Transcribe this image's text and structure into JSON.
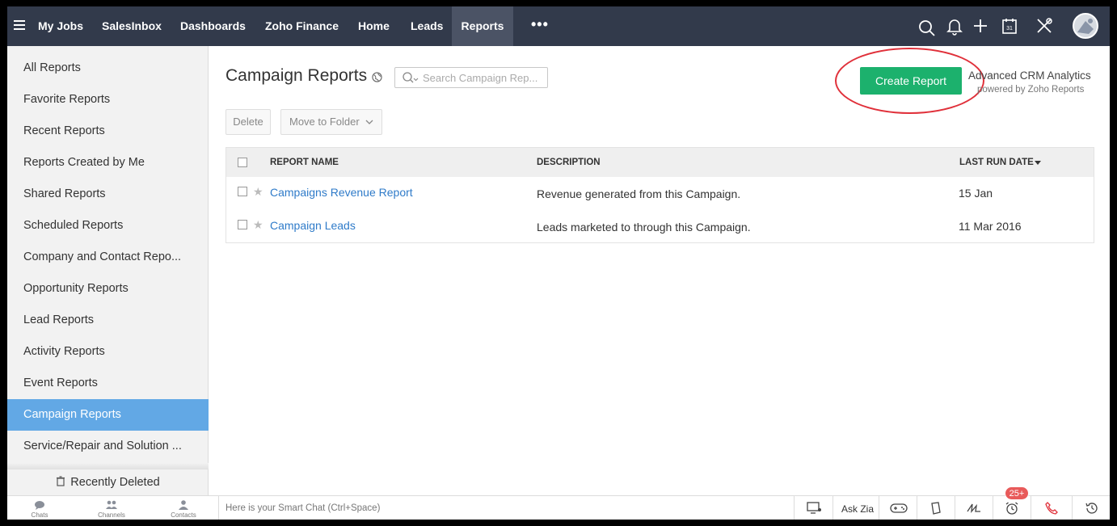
{
  "nav": {
    "items": [
      {
        "label": "My Jobs"
      },
      {
        "label": "SalesInbox"
      },
      {
        "label": "Dashboards"
      },
      {
        "label": "Zoho Finance"
      },
      {
        "label": "Home"
      },
      {
        "label": "Leads"
      },
      {
        "label": "Reports",
        "active": true
      }
    ],
    "more_label": "•••",
    "calendar_day": "31"
  },
  "sidebar": {
    "items": [
      {
        "label": "All Reports"
      },
      {
        "label": "Favorite Reports"
      },
      {
        "label": "Recent Reports"
      },
      {
        "label": "Reports Created by Me"
      },
      {
        "label": "Shared Reports"
      },
      {
        "label": "Scheduled Reports"
      },
      {
        "label": "Company and Contact Repo..."
      },
      {
        "label": "Opportunity Reports"
      },
      {
        "label": "Lead Reports"
      },
      {
        "label": "Activity Reports"
      },
      {
        "label": "Event Reports"
      },
      {
        "label": "Campaign Reports",
        "active": true
      },
      {
        "label": "Service/Repair and Solution ..."
      }
    ],
    "recently_deleted": "Recently Deleted"
  },
  "main": {
    "title": "Campaign Reports",
    "search_placeholder": "Search Campaign Rep...",
    "create_button": "Create Report",
    "analytics_title": "Advanced CRM Analytics",
    "analytics_powered": "powered by Zoho Reports",
    "delete_button": "Delete",
    "move_button": "Move to Folder"
  },
  "table": {
    "columns": {
      "name": "REPORT NAME",
      "description": "DESCRIPTION",
      "last_run": "LAST RUN DATE"
    },
    "rows": [
      {
        "name": "Campaigns Revenue Report",
        "description": "Revenue generated from this Campaign.",
        "last_run": "15 Jan"
      },
      {
        "name": "Campaign Leads",
        "description": "Leads marketed to through this Campaign.",
        "last_run": "11 Mar 2016"
      }
    ]
  },
  "bottombar": {
    "chats": "Chats",
    "channels": "Channels",
    "contacts": "Contacts",
    "smartchat_placeholder": "Here is your Smart Chat (Ctrl+Space)",
    "ask_zia": "Ask Zia",
    "badge": "25+"
  },
  "colors": {
    "nav_bg": "#323a4b",
    "accent_green": "#1cb16d",
    "sidebar_active": "#62a8e5",
    "link": "#2f7bc9",
    "highlight_red": "#e0303a"
  }
}
